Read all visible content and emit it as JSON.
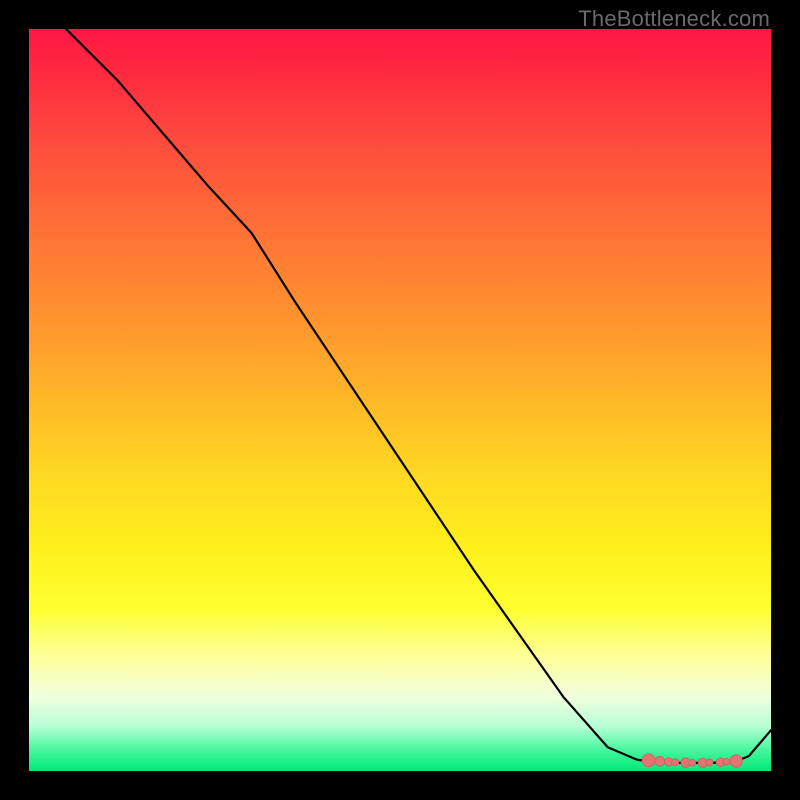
{
  "attribution": "TheBottleneck.com",
  "colors": {
    "frame": "#000000",
    "line": "#000000",
    "marker_fill": "#e57373",
    "marker_stroke": "#c95f5f"
  },
  "chart_data": {
    "type": "line",
    "title": "",
    "xlabel": "",
    "ylabel": "",
    "xlim": [
      0,
      100
    ],
    "ylim": [
      0,
      100
    ],
    "grid": false,
    "series": [
      {
        "name": "bottleneck-curve",
        "x": [
          0,
          6,
          12,
          18,
          24,
          30,
          36,
          42,
          48,
          54,
          60,
          66,
          72,
          78,
          82,
          85,
          88,
          90,
          92,
          94,
          95.5,
          97,
          100
        ],
        "y": [
          105,
          99,
          93,
          86,
          79,
          72.5,
          63,
          54,
          45,
          36,
          27,
          18.5,
          10,
          3.2,
          1.5,
          1.2,
          1.1,
          1.1,
          1.1,
          1.2,
          1.4,
          2.0,
          5.5
        ]
      }
    ],
    "markers": {
      "name": "highlight-cluster",
      "x": [
        83.5,
        85.0,
        86.2,
        87.1,
        88.5,
        89.4,
        90.8,
        91.7,
        93.2,
        94.0,
        95.3
      ],
      "y": [
        1.45,
        1.3,
        1.22,
        1.18,
        1.14,
        1.12,
        1.12,
        1.14,
        1.18,
        1.24,
        1.35
      ],
      "r": [
        6.5,
        5.0,
        4.2,
        3.6,
        4.8,
        3.4,
        4.6,
        3.6,
        4.4,
        3.4,
        6.2
      ]
    }
  }
}
